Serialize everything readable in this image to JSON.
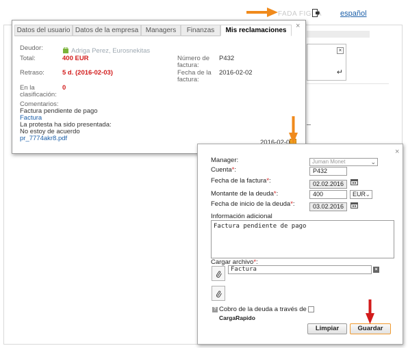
{
  "topbar": {
    "user_name": "FADA FIGRA",
    "language_link": "español"
  },
  "claims_popup": {
    "tabs": [
      {
        "label": "Datos del usuario",
        "active": false
      },
      {
        "label": "Datos de la empresa",
        "active": false
      },
      {
        "label": "Managers",
        "active": false
      },
      {
        "label": "Finanzas",
        "active": false
      },
      {
        "label": "Mis reclamaciones",
        "active": true
      }
    ],
    "close_label": "×",
    "deudor_label": "Deudor:",
    "deudor_value": "Adriga Perez, Eurosnekitas",
    "total_label": "Total:",
    "total_value": "400 EUR",
    "retraso_label": "Retraso:",
    "retraso_value": "5 d. (2016-02-03)",
    "clasificacion_label_1": "En la",
    "clasificacion_label_2": "clasificación:",
    "clasificacion_value": "0",
    "numero_label_1": "Número de",
    "numero_label_2": "factura:",
    "numero_value": "P432",
    "fecha_label_1": "Fecha de la",
    "fecha_label_2": "factura:",
    "fecha_value": "2016-02-02",
    "comments_label": "Comentarios:",
    "comments": [
      {
        "text": "Factura pendiente de pago",
        "link": false
      },
      {
        "text": "Factura",
        "link": true
      },
      {
        "text": "La protesta ha sido presentada:",
        "link": false
      },
      {
        "text": "No estoy de acuerdo",
        "link": false
      },
      {
        "text": "pr_7774akr8.pdf",
        "link": true
      }
    ],
    "entry_date": "2016-02-08"
  },
  "edit_form": {
    "close_label": "×",
    "manager_label": "Manager:",
    "manager_value": "Juman Monet",
    "cuenta_label": "Cuenta",
    "cuenta_value": "P432",
    "fecha_factura_label": "Fecha de la factura",
    "fecha_factura_value": "02.02.2016",
    "montante_label": "Montante de la deuda",
    "montante_value": "400",
    "currency_value": "EUR",
    "fecha_inicio_label": "Fecha de inicio de la deuda",
    "fecha_inicio_value": "03.02.2016",
    "info_label": "Información adicional",
    "info_value": "Factura pendiente de pago",
    "archivo_label": "Cargar archivo",
    "archivo_value": "Factura",
    "cobro_label_1": "Cobro de la deuda a través de",
    "cobro_label_2": "CargaRapido",
    "required_mark": "*",
    "required_colon": ":",
    "btn_clear": "Limpiar",
    "btn_save": "Guardar"
  },
  "colors": {
    "accent_orange": "#f08a1c",
    "error_red": "#d21b1b",
    "link_blue": "#1a5ea8"
  }
}
